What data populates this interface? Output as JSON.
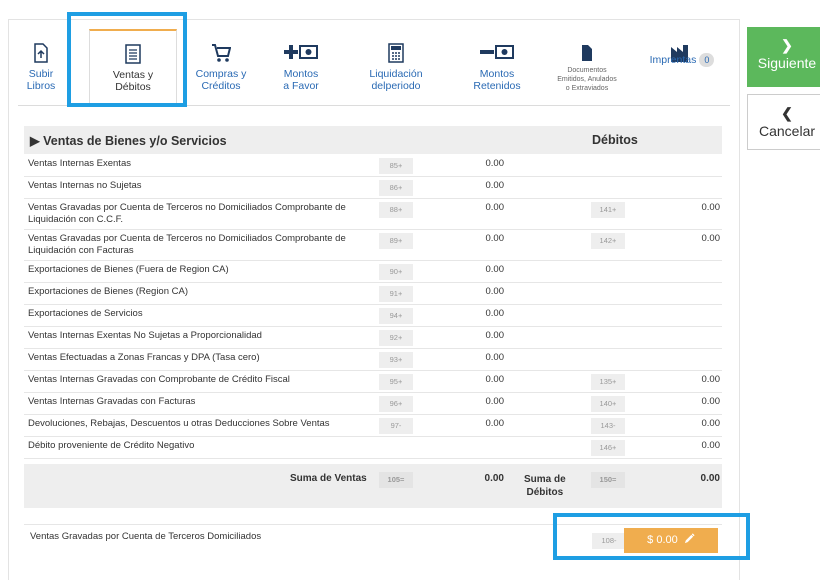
{
  "tabs": [
    {
      "label1": "Subir",
      "label2": "Libros",
      "icon": "file-upload-icon"
    },
    {
      "label1": "Ventas y",
      "label2": "Débitos",
      "icon": "list-document-icon"
    },
    {
      "label1": "Compras y",
      "label2": "Créditos",
      "icon": "cart-icon"
    },
    {
      "label1": "Montos",
      "label2": "a Favor",
      "icon": "plus-money-icon"
    },
    {
      "label1": "Liquidación",
      "label2": "delperiodo",
      "icon": "calculator-icon"
    },
    {
      "label1": "Montos",
      "label2": "Retenidos",
      "icon": "minus-money-icon"
    },
    {
      "label1": "Documentos",
      "label2": "Emitidos, Anulados",
      "label3": "o Extraviados",
      "icon": "document-icon"
    },
    {
      "label1": "Imprentas",
      "badge": "0",
      "icon": "factory-icon"
    }
  ],
  "actions": {
    "next": "Siguiente",
    "cancel": "Cancelar"
  },
  "section": {
    "title": "Ventas de Bienes y/o Servicios",
    "debits_header": "Débitos"
  },
  "rows": [
    {
      "desc": "Ventas Internas Exentas",
      "code1": "85+",
      "val1": "0.00"
    },
    {
      "desc": "Ventas Internas no Sujetas",
      "code1": "86+",
      "val1": "0.00"
    },
    {
      "desc": "Ventas Gravadas por Cuenta de Terceros no Domiciliados Comprobante de Liquidación con C.C.F.",
      "code1": "88+",
      "val1": "0.00",
      "code2": "141+",
      "val2": "0.00"
    },
    {
      "desc": "Ventas Gravadas por Cuenta de Terceros no Domiciliados Comprobante de Liquidación con Facturas",
      "code1": "89+",
      "val1": "0.00",
      "code2": "142+",
      "val2": "0.00"
    },
    {
      "desc": "Exportaciones de Bienes (Fuera de Region CA)",
      "code1": "90+",
      "val1": "0.00"
    },
    {
      "desc": "Exportaciones de Bienes (Region CA)",
      "code1": "91+",
      "val1": "0.00"
    },
    {
      "desc": "Exportaciones de Servicios",
      "code1": "94+",
      "val1": "0.00"
    },
    {
      "desc": "Ventas Internas Exentas No Sujetas a Proporcionalidad",
      "code1": "92+",
      "val1": "0.00"
    },
    {
      "desc": "Ventas Efectuadas a Zonas Francas y DPA (Tasa cero)",
      "code1": "93+",
      "val1": "0.00"
    },
    {
      "desc": "Ventas Internas Gravadas con Comprobante de Crédito Fiscal",
      "code1": "95+",
      "val1": "0.00",
      "code2": "135+",
      "val2": "0.00"
    },
    {
      "desc": "Ventas Internas Gravadas con Facturas",
      "code1": "96+",
      "val1": "0.00",
      "code2": "140+",
      "val2": "0.00"
    },
    {
      "desc": "Devoluciones, Rebajas, Descuentos u otras Deducciones Sobre Ventas",
      "code1": "97-",
      "val1": "0.00",
      "code2": "143-",
      "val2": "0.00"
    },
    {
      "desc": "Débito proveniente de Crédito Negativo",
      "code2": "146+",
      "val2": "0.00"
    }
  ],
  "summary": {
    "label1": "Suma de Ventas",
    "code1": "105=",
    "val1": "0.00",
    "label2a": "Suma de",
    "label2b": "Débitos",
    "code2": "150=",
    "val2": "0.00"
  },
  "footer": {
    "desc": "Ventas Gravadas por Cuenta de Terceros Domiciliados",
    "code": "108-",
    "amount": "$ 0.00"
  }
}
